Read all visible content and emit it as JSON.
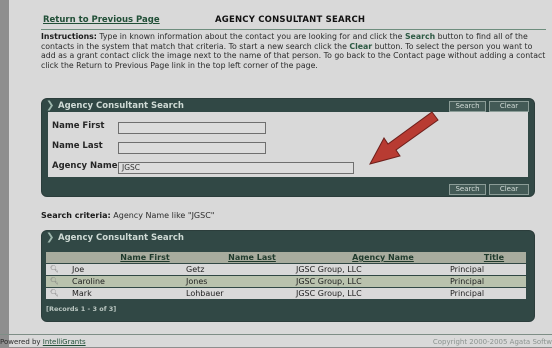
{
  "header": {
    "back_link": "Return to Previous Page",
    "title": "AGENCY CONSULTANT SEARCH"
  },
  "instructions": {
    "label": "Instructions:",
    "part1": " Type in known information about the contact you are looking for and click the ",
    "search_word": "Search",
    "part2": " button to find all of the contacts in the system that match that criteria. To start a new search click the ",
    "clear_word": "Clear",
    "part3": " button. To select the person you want to add as a grant contact click the image next to the name of that person. To go back to the Contact page without adding a contact click the Return to Previous Page link in the top left corner of the page."
  },
  "search_panel": {
    "title": "Agency Consultant Search",
    "search_button": "Search",
    "clear_button": "Clear",
    "fields": {
      "name_first_label": "Name First",
      "name_first_value": "",
      "name_last_label": "Name Last",
      "name_last_value": "",
      "agency_name_label": "Agency Name",
      "agency_name_value": "JGSC"
    }
  },
  "criteria": {
    "label": "Search criteria:",
    "text": " Agency Name like \"JGSC\""
  },
  "results_panel": {
    "title": "Agency Consultant Search",
    "columns": [
      "Name First",
      "Name Last",
      "Agency Name",
      "Title"
    ],
    "rows": [
      [
        "Joe",
        "Getz",
        "JGSC Group, LLC",
        "Principal"
      ],
      [
        "Caroline",
        "Jones",
        "JGSC Group, LLC",
        "Principal"
      ],
      [
        "Mark",
        "Lohbauer",
        "JGSC Group, LLC",
        "Principal"
      ]
    ],
    "records": "[Records 1 - 3 of 3]"
  },
  "footer": {
    "powered_by": "Powered by ",
    "brand": "IntelliGrants",
    "copyright": "Copyright 2000-2005 Agata Softw"
  },
  "colors": {
    "panel": "#314845",
    "arrow": "#c0392b",
    "link": "#214f37"
  },
  "icons": {
    "row_select": "magnifier-icon",
    "panel_title": "chevron-icon",
    "annotation": "red-arrow"
  }
}
